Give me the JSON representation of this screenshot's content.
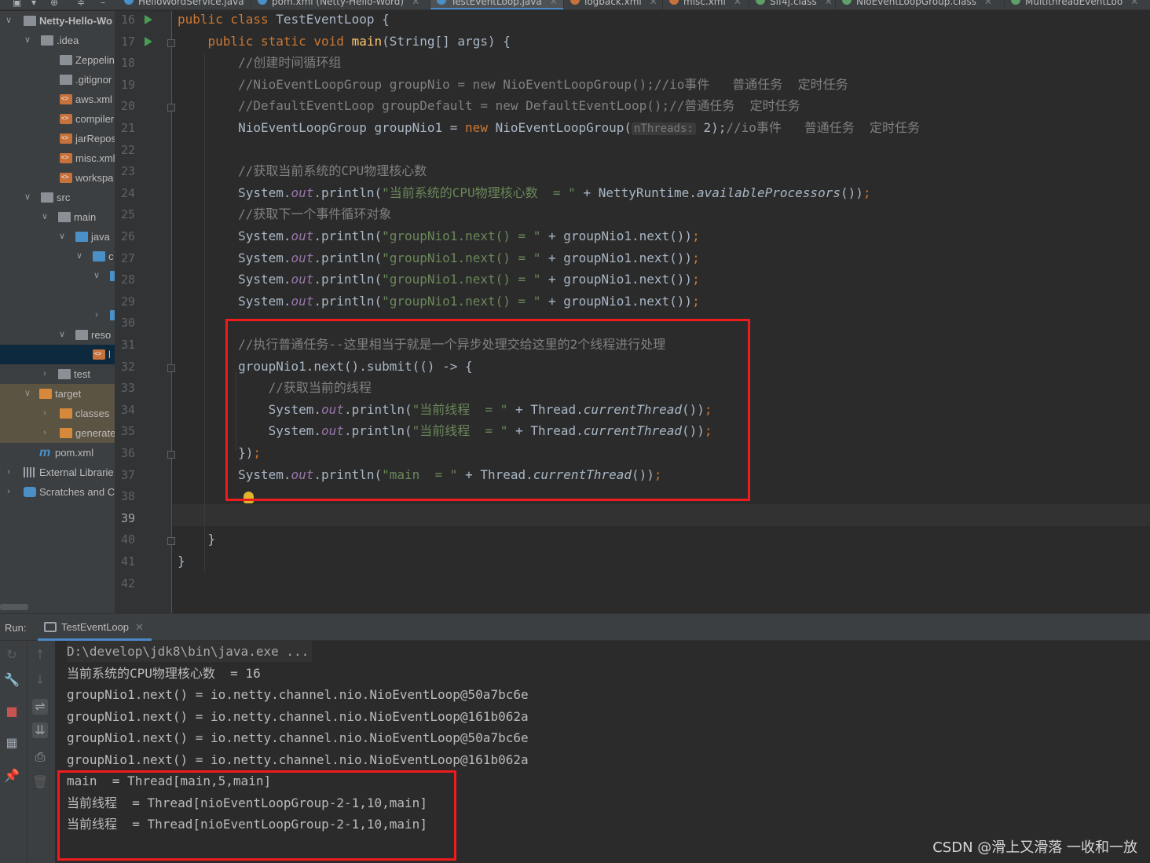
{
  "tabs": [
    {
      "label": "HelloWordService.java",
      "active": false,
      "icon": "java-class-icon"
    },
    {
      "label": "pom.xml (Netty-Hello-Word)",
      "active": false,
      "icon": "maven-icon"
    },
    {
      "label": "TestEventLoop.java",
      "active": true,
      "icon": "java-class-icon"
    },
    {
      "label": "logback.xml",
      "active": false,
      "icon": "xml-icon"
    },
    {
      "label": "misc.xml",
      "active": false,
      "icon": "xml-icon"
    },
    {
      "label": "Slf4j.class",
      "active": false,
      "icon": "class-icon"
    },
    {
      "label": "NioEventLoopGroup.class",
      "active": false,
      "icon": "class-icon"
    },
    {
      "label": "MultithreadEventLoo",
      "active": false,
      "icon": "class-icon"
    }
  ],
  "project_tree": [
    {
      "label": "Netty-Hello-Wo",
      "icon": "module-folder-icon",
      "arrow": "down",
      "bold": true
    },
    {
      "label": ".idea",
      "icon": "folder-icon",
      "arrow": "down"
    },
    {
      "label": "Zeppelin",
      "icon": "folder-icon",
      "arrow": ""
    },
    {
      "label": ".gitignor",
      "icon": "file-icon",
      "arrow": ""
    },
    {
      "label": "aws.xml",
      "icon": "xml-file-icon",
      "arrow": ""
    },
    {
      "label": "compiler",
      "icon": "xml-file-icon",
      "arrow": ""
    },
    {
      "label": "jarRepos",
      "icon": "xml-file-icon",
      "arrow": ""
    },
    {
      "label": "misc.xml",
      "icon": "xml-file-icon",
      "arrow": ""
    },
    {
      "label": "workspa",
      "icon": "xml-file-icon",
      "arrow": ""
    },
    {
      "label": "src",
      "icon": "folder-icon",
      "arrow": "down"
    },
    {
      "label": "main",
      "icon": "folder-icon",
      "arrow": "down"
    },
    {
      "label": "java",
      "icon": "source-folder-icon",
      "arrow": "down"
    },
    {
      "label": "c",
      "icon": "package-icon",
      "arrow": "down"
    },
    {
      "label": "",
      "icon": "package-icon",
      "arrow": "down"
    },
    {
      "label": "",
      "icon": "",
      "arrow": ""
    },
    {
      "label": "",
      "icon": "package-icon",
      "arrow": "right"
    },
    {
      "label": "reso",
      "icon": "resources-folder-icon",
      "arrow": "down"
    },
    {
      "label": "l",
      "icon": "xml-file-icon",
      "arrow": "",
      "selected": true
    },
    {
      "label": "test",
      "icon": "folder-icon",
      "arrow": "right"
    },
    {
      "label": "target",
      "icon": "excluded-folder-icon",
      "arrow": "down",
      "excluded": true
    },
    {
      "label": "classes",
      "icon": "excluded-folder-icon",
      "arrow": "right",
      "excluded": true
    },
    {
      "label": "generate",
      "icon": "excluded-folder-icon",
      "arrow": "right",
      "excluded": true
    },
    {
      "label": "pom.xml",
      "icon": "maven-icon",
      "arrow": ""
    },
    {
      "label": "External Librarie",
      "icon": "library-icon",
      "arrow": "right"
    },
    {
      "label": "Scratches and C",
      "icon": "scratches-icon",
      "arrow": "right"
    }
  ],
  "editor": {
    "line_numbers": [
      "16",
      "17",
      "18",
      "19",
      "20",
      "21",
      "22",
      "23",
      "24",
      "25",
      "26",
      "27",
      "28",
      "29",
      "30",
      "31",
      "32",
      "33",
      "34",
      "35",
      "36",
      "37",
      "38",
      "39",
      "40",
      "41",
      "42"
    ],
    "current_line": "39",
    "lines": [
      [
        [
          "kw",
          "public class "
        ],
        [
          "",
          "TestEventLoop {"
        ]
      ],
      [
        [
          "",
          "    "
        ],
        [
          "kw",
          "public static void "
        ],
        [
          "mth",
          "main"
        ],
        [
          "",
          "(String[] args) {"
        ]
      ],
      [
        [
          "cmt",
          "        //创建时间循环组"
        ]
      ],
      [
        [
          "cmt",
          "        //NioEventLoopGroup groupNio = new NioEventLoopGroup();//io事件   普通任务  定时任务"
        ]
      ],
      [
        [
          "cmt",
          "        //DefaultEventLoop groupDefault = new DefaultEventLoop();//普通任务  定时任务"
        ]
      ],
      [
        [
          "",
          "        NioEventLoopGroup groupNio1 = "
        ],
        [
          "kw",
          "new "
        ],
        [
          "",
          "NioEventLoopGroup("
        ],
        [
          "hint",
          "nThreads:"
        ],
        [
          "",
          " 2);"
        ],
        [
          "cmt",
          "//io事件   普通任务  定时任务"
        ]
      ],
      [
        [
          "",
          ""
        ]
      ],
      [
        [
          "cmt",
          "        //获取当前系统的CPU物理核心数"
        ]
      ],
      [
        [
          "",
          "        System."
        ],
        [
          "fld",
          "out"
        ],
        [
          "",
          ".println("
        ],
        [
          "str",
          "\"当前系统的CPU物理核心数  = \""
        ],
        [
          "",
          " + NettyRuntime."
        ],
        [
          "ital",
          "availableProcessors"
        ],
        [
          "",
          "())"
        ],
        [
          "kw",
          ";"
        ]
      ],
      [
        [
          "cmt",
          "        //获取下一个事件循环对象"
        ]
      ],
      [
        [
          "",
          "        System."
        ],
        [
          "fld",
          "out"
        ],
        [
          "",
          ".println("
        ],
        [
          "str",
          "\"groupNio1.next() = \""
        ],
        [
          "",
          " + groupNio1.next())"
        ],
        [
          "kw",
          ";"
        ]
      ],
      [
        [
          "",
          "        System."
        ],
        [
          "fld",
          "out"
        ],
        [
          "",
          ".println("
        ],
        [
          "str",
          "\"groupNio1.next() = \""
        ],
        [
          "",
          " + groupNio1.next())"
        ],
        [
          "kw",
          ";"
        ]
      ],
      [
        [
          "",
          "        System."
        ],
        [
          "fld",
          "out"
        ],
        [
          "",
          ".println("
        ],
        [
          "str",
          "\"groupNio1.next() = \""
        ],
        [
          "",
          " + groupNio1.next())"
        ],
        [
          "kw",
          ";"
        ]
      ],
      [
        [
          "",
          "        System."
        ],
        [
          "fld",
          "out"
        ],
        [
          "",
          ".println("
        ],
        [
          "str",
          "\"groupNio1.next() = \""
        ],
        [
          "",
          " + groupNio1.next())"
        ],
        [
          "kw",
          ";"
        ]
      ],
      [
        [
          "",
          ""
        ]
      ],
      [
        [
          "cmt",
          "        //执行普通任务--这里相当于就是一个异步处理交给这里的2个线程进行处理"
        ]
      ],
      [
        [
          "",
          "        groupNio1.next().submit(() -> {"
        ]
      ],
      [
        [
          "cmt",
          "            //获取当前的线程"
        ]
      ],
      [
        [
          "",
          "            System."
        ],
        [
          "fld",
          "out"
        ],
        [
          "",
          ".println("
        ],
        [
          "str",
          "\"当前线程  = \""
        ],
        [
          "",
          " + Thread."
        ],
        [
          "ital",
          "currentThread"
        ],
        [
          "",
          "())"
        ],
        [
          "kw",
          ";"
        ]
      ],
      [
        [
          "",
          "            System."
        ],
        [
          "fld",
          "out"
        ],
        [
          "",
          ".println("
        ],
        [
          "str",
          "\"当前线程  = \""
        ],
        [
          "",
          " + Thread."
        ],
        [
          "ital",
          "currentThread"
        ],
        [
          "",
          "())"
        ],
        [
          "kw",
          ";"
        ]
      ],
      [
        [
          "",
          "        })"
        ],
        [
          "kw",
          ";"
        ]
      ],
      [
        [
          "",
          "        System."
        ],
        [
          "fld",
          "out"
        ],
        [
          "",
          ".println("
        ],
        [
          "str",
          "\"main  = \""
        ],
        [
          "",
          " + Thread."
        ],
        [
          "ital",
          "currentThread"
        ],
        [
          "",
          "())"
        ],
        [
          "kw",
          ";"
        ]
      ],
      [
        [
          "",
          ""
        ]
      ],
      [
        [
          "",
          ""
        ]
      ],
      [
        [
          "",
          "    }"
        ]
      ],
      [
        [
          "",
          "}"
        ]
      ],
      [
        [
          "",
          ""
        ]
      ]
    ]
  },
  "run_panel": {
    "label": "Run:",
    "tab": "TestEventLoop",
    "toolbar": [
      {
        "icon": "rerun-icon",
        "enabled": false
      },
      {
        "icon": "wrench-icon",
        "enabled": true
      },
      {
        "icon": "stop-icon",
        "enabled": true
      },
      {
        "icon": "layout-icon",
        "enabled": true
      },
      {
        "icon": "pin-icon",
        "enabled": true
      },
      {
        "icon": "up-arrow-icon",
        "enabled": false
      },
      {
        "icon": "down-arrow-icon",
        "enabled": false
      },
      {
        "icon": "soft-wrap-icon",
        "enabled": true
      },
      {
        "icon": "scroll-to-end-icon",
        "enabled": true
      },
      {
        "icon": "print-icon",
        "enabled": true
      },
      {
        "icon": "trash-icon",
        "enabled": false
      }
    ],
    "console_lines": [
      "D:\\develop\\jdk8\\bin\\java.exe ...",
      "当前系统的CPU物理核心数  = 16",
      "groupNio1.next() = io.netty.channel.nio.NioEventLoop@50a7bc6e",
      "groupNio1.next() = io.netty.channel.nio.NioEventLoop@161b062a",
      "groupNio1.next() = io.netty.channel.nio.NioEventLoop@50a7bc6e",
      "groupNio1.next() = io.netty.channel.nio.NioEventLoop@161b062a",
      "main  = Thread[main,5,main]",
      "当前线程  = Thread[nioEventLoopGroup-2-1,10,main]",
      "当前线程  = Thread[nioEventLoopGroup-2-1,10,main]"
    ]
  },
  "watermark": "CSDN @滑上又滑落 一收和一放",
  "colors": {
    "annotation_red": "#ee1c1c",
    "keyword": "#cc7832",
    "string": "#6a8759",
    "comment": "#808080",
    "method": "#ffc66d",
    "field": "#9876aa"
  }
}
